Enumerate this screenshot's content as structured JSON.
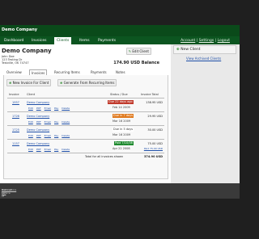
{
  "app": {
    "title": "Demo Company"
  },
  "nav": {
    "tabs": [
      "Dashboard",
      "Invoices",
      "Clients",
      "Items",
      "Payments"
    ],
    "active": "Clients",
    "account_label": "Account",
    "settings_label": "Settings",
    "logout_label": "Logout",
    "separator": "|"
  },
  "client": {
    "name": "Demo Company",
    "contact": "John Doe",
    "street": "123 Testing Dr",
    "city": "Testville, OK 74747",
    "edit_label": "Edit Client",
    "balance": "174.90 USD Balance"
  },
  "subtabs": [
    "Overview",
    "Invoices",
    "Recurring Items",
    "Payments",
    "Notes"
  ],
  "active_subtab": "Invoices",
  "actions": {
    "new_invoice": "New Invoice For Client",
    "generate": "Generate From Recurring Items"
  },
  "table": {
    "headers": {
      "invoice": "Invoice",
      "client": "Client",
      "status": "Status / Due",
      "total": "Invoice Total"
    },
    "row_actions": [
      "Edit",
      "PDF",
      "Email",
      "Pay",
      "Delete"
    ],
    "rows": [
      {
        "invoice": "1957",
        "client": "Demo Company",
        "status": "Due 22 days ago",
        "status_color": "#c0392b",
        "date": "Feb 14 2009",
        "total": "138.95 USD",
        "total_sub": ""
      },
      {
        "invoice": "1726",
        "client": "Demo Company",
        "status": "Due in 7 days",
        "status_color": "#e07a1f",
        "date": "Mar 16 2009",
        "total": "29.95 USD",
        "total_sub": ""
      },
      {
        "invoice": "1725",
        "client": "Demo Company",
        "status": "Due in 5 days",
        "status_color": "#ffffff",
        "date": "Mar 16 2009",
        "total": "30.00 USD",
        "total_sub": ""
      },
      {
        "invoice": "1157",
        "client": "Demo Company",
        "status": "Paid 7/10/08",
        "status_color": "#1e8a2e",
        "date": "Apr 22 2008",
        "total": "75.00 USD",
        "total_sub": "Paid 75.00 USD"
      }
    ],
    "footer_label": "Total for all invoices shown",
    "footer_total": "374.90 USD"
  },
  "sidebar": {
    "new_client": "New Client",
    "archived": "View Archived Clients"
  },
  "footer": {
    "brand": "InvoiceMore",
    "text": " is a service of ",
    "company": "Kolmiss, LLC"
  },
  "colors": {
    "header_bg": "#0a4a1a",
    "nav_bg": "#0c5520",
    "link": "#1f4fa8",
    "overdue": "#c0392b",
    "soon": "#e07a1f",
    "paid": "#1e8a2e"
  }
}
